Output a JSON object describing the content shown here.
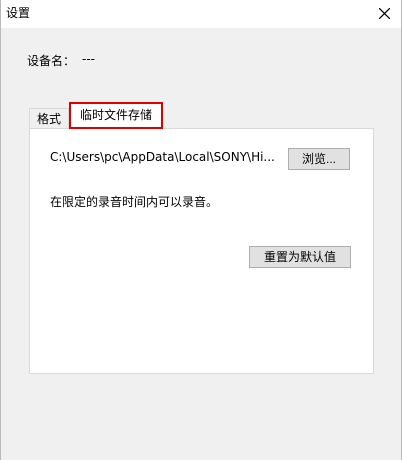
{
  "window": {
    "title": "设置",
    "close_icon": "close-icon"
  },
  "device": {
    "label": "设备名：",
    "value": "---"
  },
  "tabs": [
    {
      "label": "格式",
      "active": false
    },
    {
      "label": "临时文件存储",
      "active": true,
      "highlight_color": "#e00000"
    }
  ],
  "storage": {
    "path": "C:\\Users\\pc\\AppData\\Local\\SONY\\Hi...",
    "browse_label": "浏览...",
    "info_text": "在限定的录音时间内可以录音。",
    "reset_label": "重置为默认值"
  },
  "colors": {
    "background": "#f0f0f0",
    "panel": "#ffffff",
    "highlight": "#e00000"
  }
}
